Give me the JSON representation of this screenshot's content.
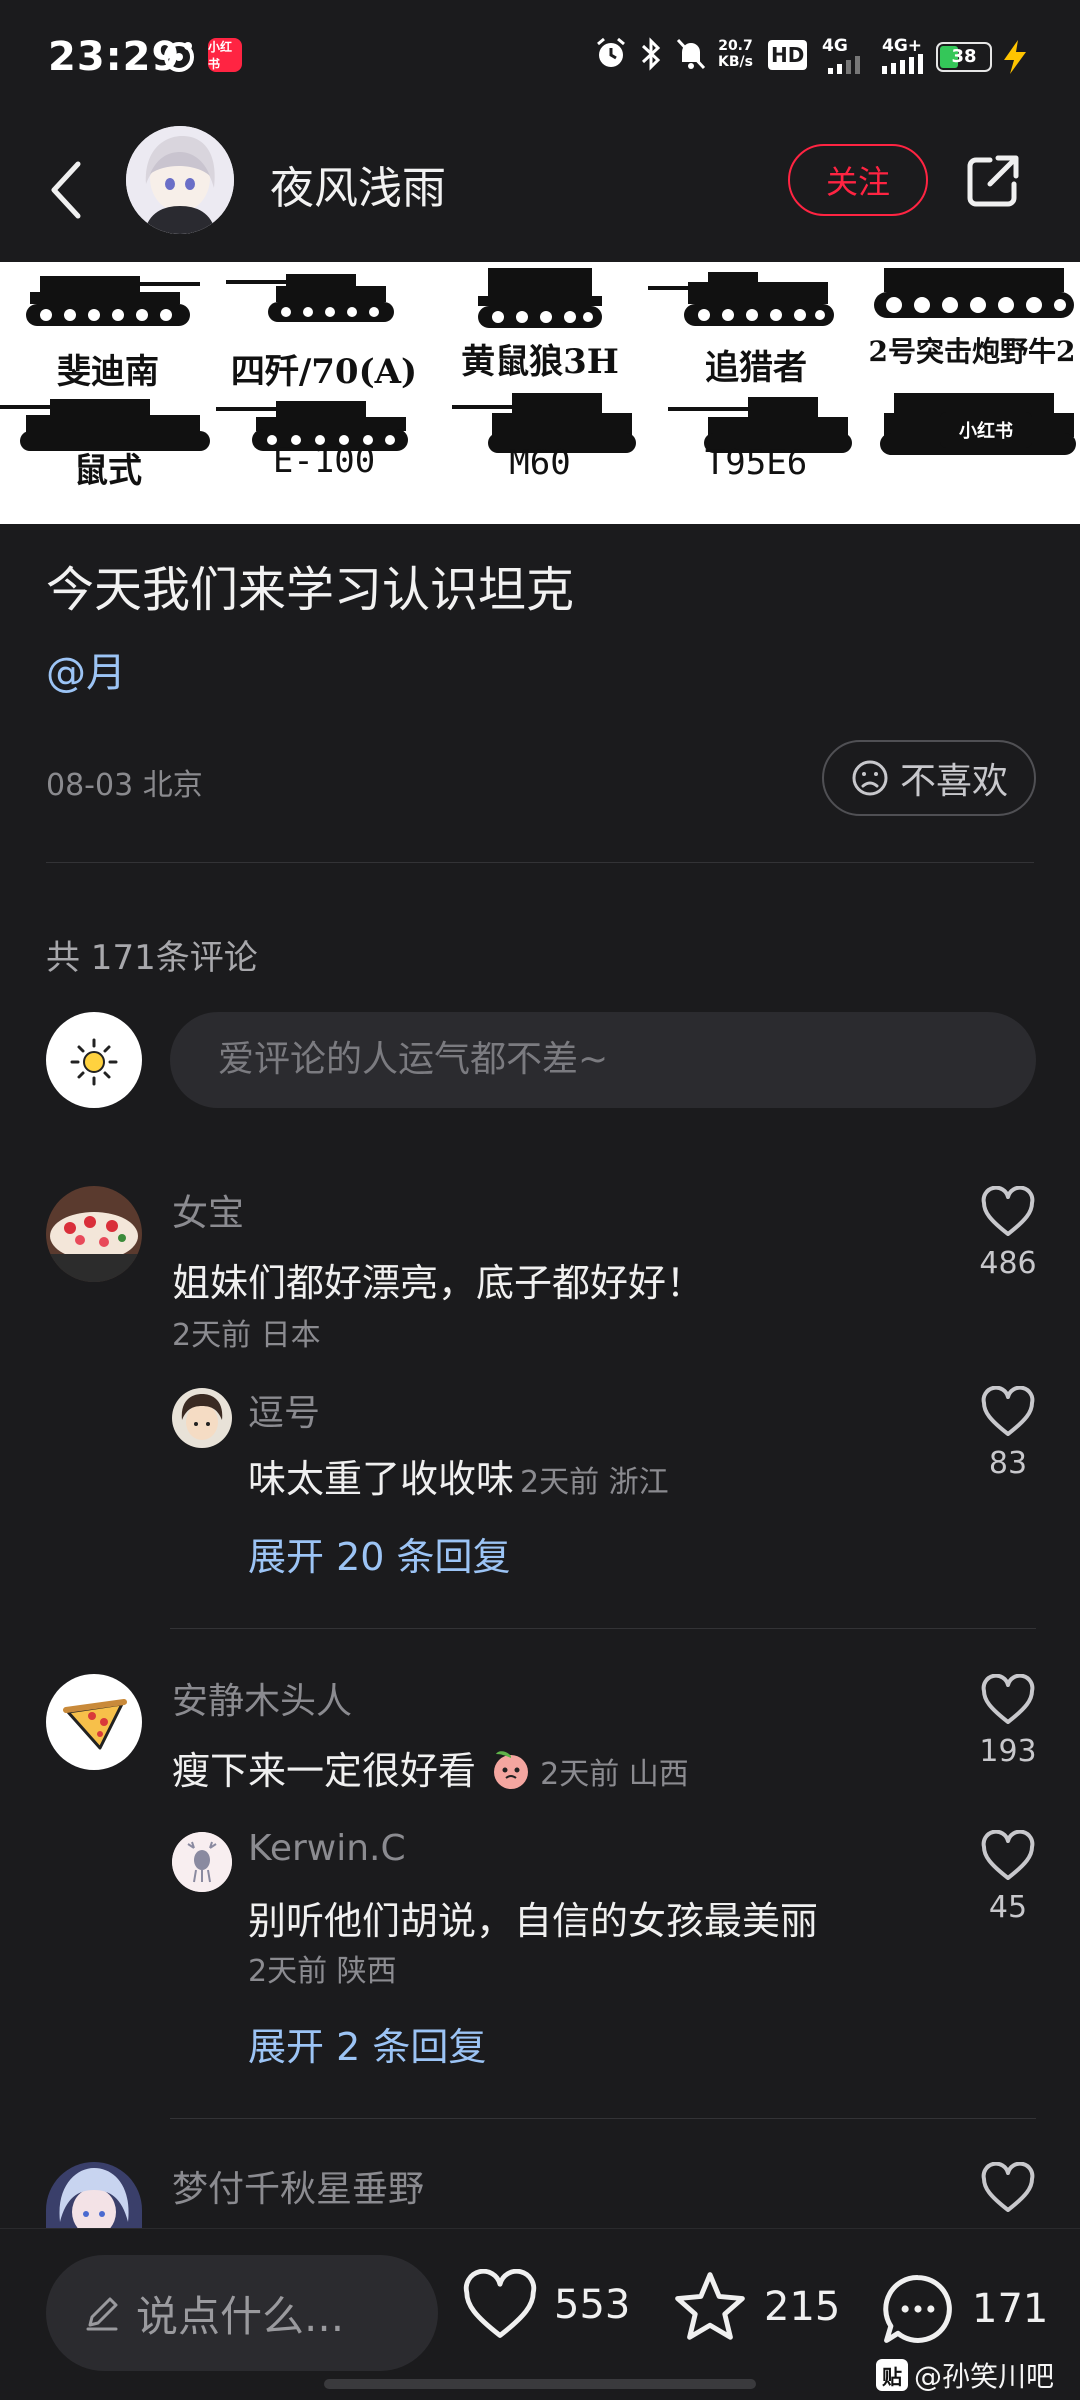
{
  "status_bar": {
    "time": "23:29",
    "app_chip": "小红书",
    "net_speed_value": "20.7",
    "net_speed_unit": "KB/s",
    "hd_badge": "HD",
    "signal_1": "4G",
    "signal_2": "4G+",
    "battery": "38",
    "battery_level": 0.38,
    "icons": [
      "alarm-icon",
      "bluetooth-icon",
      "mute-icon",
      "wifi-icon",
      "charging-icon"
    ]
  },
  "header": {
    "author_name": "夜风浅雨",
    "follow_label": "关注",
    "icons": [
      "back-icon",
      "share-icon"
    ]
  },
  "banner": {
    "top_row": [
      "斐迪南",
      "四歼/70(A)",
      "黄鼠狼3H",
      "追猎者",
      "2号突击炮野牛2"
    ],
    "bottom_row": [
      "鼠式",
      "E-100",
      "M60",
      "T95E6",
      ""
    ],
    "brand_mark": "小红书"
  },
  "post": {
    "title": "今天我们来学习认识坦克",
    "mention": "@月",
    "meta": "08-03 北京",
    "dislike_label": "不喜欢"
  },
  "comments_section": {
    "count_label": "共 171条评论",
    "input_placeholder": "爱评论的人运气都不差~"
  },
  "comments": [
    {
      "user": "女宝",
      "text": "姐妹们都好漂亮，底子都好好！",
      "meta": "2天前 日本",
      "likes": "486",
      "reply": {
        "user": "逗号",
        "text": "味太重了收收味",
        "meta": "2天前 浙江",
        "likes": "83"
      },
      "expand_label": "展开 20 条回复"
    },
    {
      "user": "安静木头人",
      "text": "瘦下来一定很好看",
      "meta": "2天前 山西",
      "likes": "193",
      "reply": {
        "user": "Kerwin.C",
        "text": "别听他们胡说，自信的女孩最美丽",
        "meta": "2天前 陕西",
        "likes": "45"
      },
      "expand_label": "展开 2 条回复"
    },
    {
      "user": "梦付千秋星垂野"
    }
  ],
  "bottom_bar": {
    "input_placeholder": "说点什么...",
    "likes": "553",
    "stars": "215",
    "comments": "171"
  },
  "watermark": {
    "logo": "贴",
    "text": "@孙笑川吧"
  },
  "colors": {
    "background": "#1b1b1d",
    "accent": "#ff2442",
    "link": "#9cc4f5"
  }
}
